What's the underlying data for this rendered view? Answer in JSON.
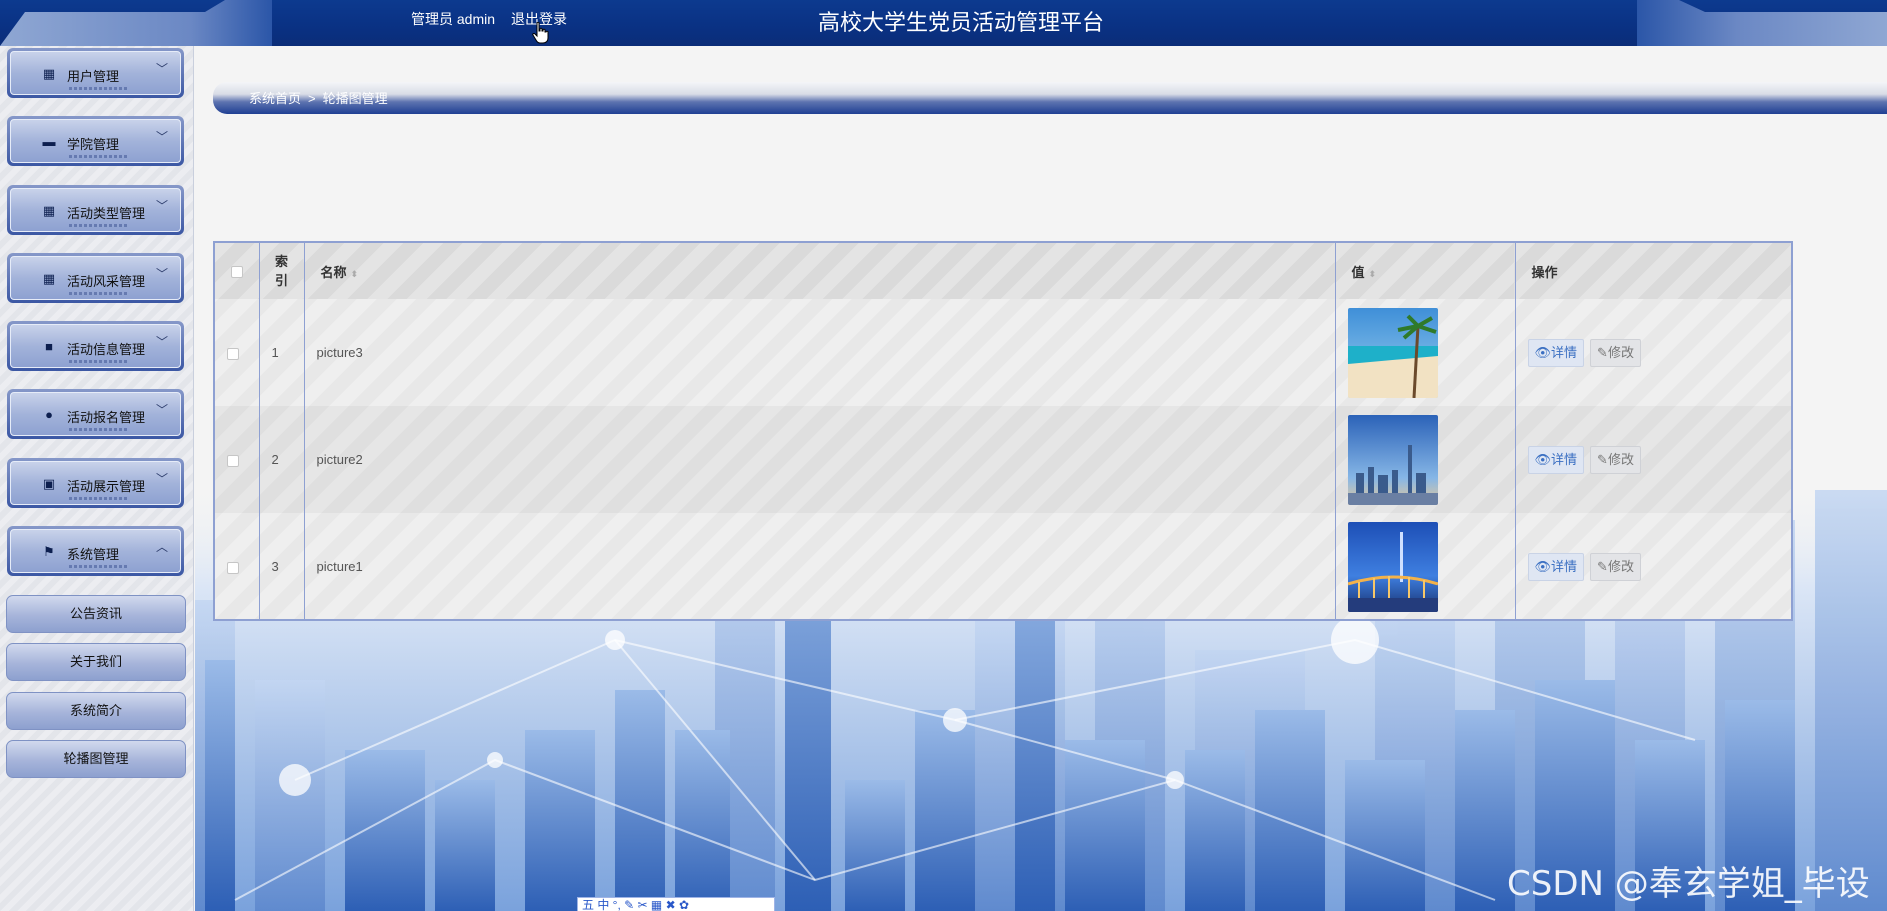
{
  "header": {
    "user_text": "管理员 admin",
    "logout_label": "退出登录",
    "title": "高校大学生党员活动管理平台"
  },
  "sidebar": {
    "menus": [
      {
        "label": "用户管理",
        "icon": "grid-icon",
        "chevron": "down"
      },
      {
        "label": "学院管理",
        "icon": "monitor-icon",
        "chevron": "down"
      },
      {
        "label": "活动类型管理",
        "icon": "grid-icon",
        "chevron": "down"
      },
      {
        "label": "活动风采管理",
        "icon": "grid-icon",
        "chevron": "down"
      },
      {
        "label": "活动信息管理",
        "icon": "video-camera-icon",
        "chevron": "down"
      },
      {
        "label": "活动报名管理",
        "icon": "user-icon",
        "chevron": "down"
      },
      {
        "label": "活动展示管理",
        "icon": "clipboard-icon",
        "chevron": "down"
      },
      {
        "label": "系统管理",
        "icon": "flag-icon",
        "chevron": "up"
      }
    ],
    "submenus": [
      "公告资讯",
      "关于我们",
      "系统简介",
      "轮播图管理"
    ]
  },
  "breadcrumb": {
    "home": "系统首页",
    "separator": ">",
    "current": "轮播图管理"
  },
  "table": {
    "headers": {
      "index": "索引",
      "name": "名称",
      "value": "值",
      "actions": "操作"
    },
    "rows": [
      {
        "index": "1",
        "name": "picture3",
        "thumb": "beach"
      },
      {
        "index": "2",
        "name": "picture2",
        "thumb": "skyline"
      },
      {
        "index": "3",
        "name": "picture1",
        "thumb": "bridge"
      }
    ],
    "detail_label": "详情",
    "edit_label": "修改"
  },
  "toolbar_ime": "五 中 °, ✎ ✂ ▦ ✖ ✿",
  "watermark": "CSDN @奉玄学姐_毕设",
  "colors": {
    "header_blue": "#0a3183",
    "accent_link": "#3a6fc2",
    "table_border": "#8ea0d2"
  }
}
